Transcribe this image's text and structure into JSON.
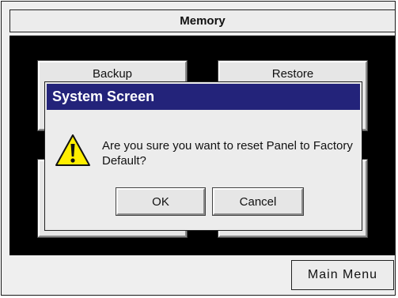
{
  "screen": {
    "title": "Memory",
    "buttons": [
      {
        "label": "Backup"
      },
      {
        "label": "Restore"
      },
      {
        "label": ""
      },
      {
        "label": ""
      }
    ],
    "main_menu_label": "Main Menu"
  },
  "dialog": {
    "title": "System Screen",
    "message": "Are you sure you want to reset Panel to Factory Default?",
    "icon": "warning-icon",
    "ok_label": "OK",
    "cancel_label": "Cancel"
  },
  "colors": {
    "dialog_title_bg": "#23237a",
    "warning_yellow": "#ffee00",
    "panel_bg": "#000000"
  }
}
